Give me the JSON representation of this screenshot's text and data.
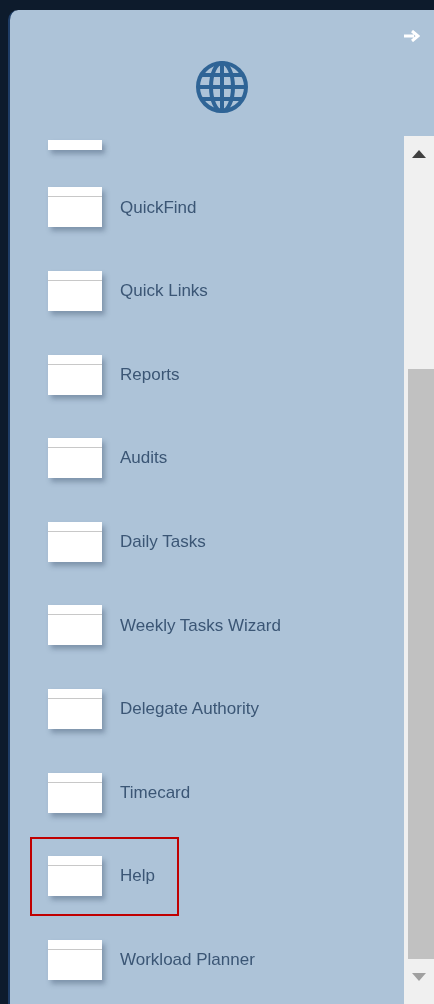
{
  "menu": {
    "items": [
      {
        "label": "QuickFind",
        "selected": false
      },
      {
        "label": "Quick Links",
        "selected": false
      },
      {
        "label": "Reports",
        "selected": false
      },
      {
        "label": "Audits",
        "selected": false
      },
      {
        "label": "Daily Tasks",
        "selected": false
      },
      {
        "label": "Weekly Tasks Wizard",
        "selected": false
      },
      {
        "label": "Delegate Authority",
        "selected": false
      },
      {
        "label": "Timecard",
        "selected": false
      },
      {
        "label": "Help",
        "selected": true
      },
      {
        "label": "Workload Planner",
        "selected": false
      }
    ]
  }
}
